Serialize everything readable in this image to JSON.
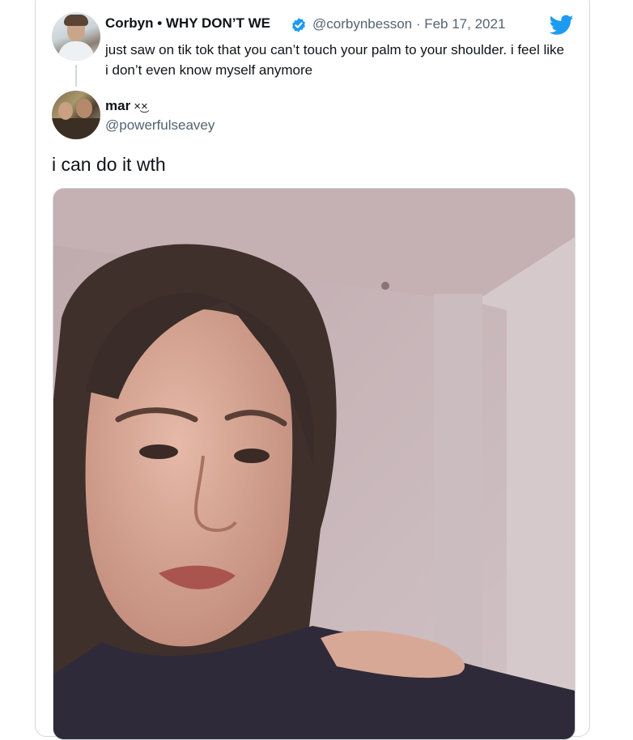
{
  "quoted_tweet": {
    "display_name": "Corbyn • WHY DON’T WE",
    "verified": true,
    "handle_date": "@corbynbesson · Feb 17, 2021",
    "text": "just saw on tik tok that you can’t touch your palm to your shoulder. i feel like i don’t even know myself anymore"
  },
  "reply_tweet": {
    "display_name": "mar",
    "name_emoji": "×͜×",
    "handle": "@powerfulseavey",
    "text": "i can do it wth"
  },
  "icons": {
    "platform": "twitter-bird-icon",
    "verified": "verified-badge-icon"
  },
  "colors": {
    "twitter_blue": "#1d9bf0",
    "secondary_text": "#536471",
    "border": "#cfd9de"
  }
}
